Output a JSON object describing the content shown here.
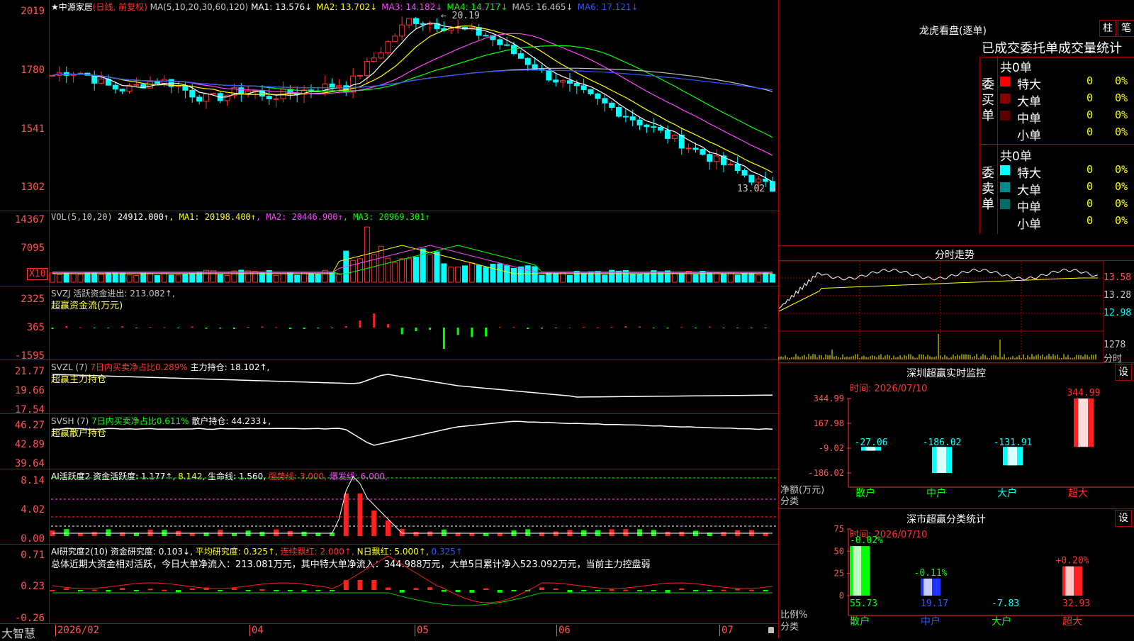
{
  "price_panel": {
    "symbol": "中源家居",
    "mode": "(日线, 前复权)",
    "ma_label": "MA(5,10,20,30,60,120)",
    "ma": [
      {
        "label": "MA1: 13.576↓",
        "color": "#ffffff"
      },
      {
        "label": "MA2: 13.702↓",
        "color": "#ffff00"
      },
      {
        "label": "MA3: 14.182↓",
        "color": "#ff44ff"
      },
      {
        "label": "MA4: 14.717↓",
        "color": "#00ff00"
      },
      {
        "label": "MA5: 16.465↓",
        "color": "#c0c0c0"
      },
      {
        "label": "MA6: 17.121↓",
        "color": "#3355ff"
      }
    ],
    "y_ticks": [
      "2019",
      "1780",
      "1541",
      "1302"
    ],
    "high_label": "20.19",
    "low_label": "13.02"
  },
  "vol_panel": {
    "header": "VOL(5,10,20)",
    "value": "24912.000↑",
    "ma": [
      {
        "label": "MA1: 20198.400↑",
        "color": "#ffff00"
      },
      {
        "label": "MA2: 20446.900↑",
        "color": "#ff44ff"
      },
      {
        "label": "MA3: 20969.301↑",
        "color": "#00ff00"
      }
    ],
    "y_ticks": [
      "14367",
      "7095"
    ],
    "unit": "X10"
  },
  "svzj_panel": {
    "header": "SVZJ 活跃资金进出: 213.082↑,",
    "subtitle": "超赢资金流(万元)",
    "y_ticks": [
      "2325",
      "365",
      "-1595"
    ]
  },
  "svzl_panel": {
    "header_prefix": "SVZL (7)",
    "header_red": "7日内买卖净占比0.289%",
    "header_rest": "主力持仓: 18.102↑,",
    "subtitle": "超赢主力持仓",
    "y_ticks": [
      "21.77",
      "19.66",
      "17.54"
    ]
  },
  "svsh_panel": {
    "header_prefix": "SVSH (7)",
    "header_green": "7日内买卖净占比0.611%",
    "header_rest": "散户持仓: 44.233↓,",
    "subtitle": "超赢散户持仓",
    "y_ticks": [
      "46.27",
      "42.89",
      "39.64"
    ]
  },
  "ai_active_panel": {
    "h1": "AI活跃度2 资金活跃度: 1.177↑,",
    "h2": "8.142,",
    "h3": "生命线: 1.560,",
    "h4": "强势线: 3.000,",
    "h5": "爆发线: 6.000,",
    "y_ticks": [
      "8.14",
      "4.02",
      "0.00"
    ]
  },
  "ai_research_panel": {
    "h1": "AI研究度2(10) 资金研究度: 0.103↓,",
    "h2": "平均研究度: 0.325↑,",
    "h3": "连续飘红: 2.000↑,",
    "h4": "N日飘红: 5.000↑,",
    "h5": "0.325↑",
    "summary": "总体近期大资金相对活跃，今日大单净流入：213.081万元，其中特大单净流入：344.988万元，大单5日累计净入523.092万元，当前主力控盘弱",
    "y_ticks": [
      "0.71",
      "0.23",
      "-0.26"
    ]
  },
  "date_axis": {
    "app_name": "大智慧",
    "labels": [
      "2026/02",
      "04",
      "05",
      "06",
      "07"
    ]
  },
  "dragon_tiger": {
    "title": "龙虎看盘(逐单)",
    "btn1": "柱",
    "btn2": "笔",
    "tabs": "已成交委托单成交量统计",
    "buy": {
      "label": "委买单",
      "total": "共0单",
      "rows": [
        {
          "name": "特大",
          "count": "0",
          "pct": "0%",
          "color": "#ff0000"
        },
        {
          "name": "大单",
          "count": "0",
          "pct": "0%",
          "color": "#8b0000"
        },
        {
          "name": "中单",
          "count": "0",
          "pct": "0%",
          "color": "#5a0000"
        },
        {
          "name": "小单",
          "count": "0",
          "pct": "0%",
          "color": "#000000"
        }
      ]
    },
    "sell": {
      "label": "委卖单",
      "total": "共0单",
      "rows": [
        {
          "name": "特大",
          "count": "0",
          "pct": "0%",
          "color": "#00ffff"
        },
        {
          "name": "大单",
          "count": "0",
          "pct": "0%",
          "color": "#008b8b"
        },
        {
          "name": "中单",
          "count": "0",
          "pct": "0%",
          "color": "#006b6b"
        },
        {
          "name": "小单",
          "count": "0",
          "pct": "0%",
          "color": "#000000"
        }
      ]
    }
  },
  "intraday": {
    "title": "分时走势",
    "y_ticks": [
      "13.58",
      "13.28",
      "12.98"
    ],
    "vol_label": "1278",
    "vol_unit": "分时"
  },
  "monitor": {
    "title": "深圳超赢实时监控",
    "settings": "设",
    "time": "时间: 2026/07/10",
    "y_ticks": [
      "344.99",
      "167.98",
      "-9.02",
      "-186.02"
    ],
    "ylabel": "净额(万元)",
    "xlabel": "分类",
    "bars": [
      {
        "name": "散户",
        "value": -27.06,
        "label": "-27.06",
        "color": "#00ffff"
      },
      {
        "name": "中户",
        "value": -186.02,
        "label": "-186.02",
        "color": "#00ffff"
      },
      {
        "name": "大户",
        "value": -131.91,
        "label": "-131.91",
        "color": "#00ffff"
      },
      {
        "name": "超大",
        "value": 344.99,
        "label": "344.99",
        "color": "#ff3333"
      }
    ]
  },
  "classify": {
    "title": "深市超赢分类统计",
    "settings": "设",
    "time": "时间: 2026/07/10",
    "y_ticks": [
      "75",
      "50",
      "25",
      "0"
    ],
    "ylabel": "比例%",
    "xlabel": "分类",
    "bars": [
      {
        "name": "散户",
        "value": 55.73,
        "top": "-0.02%",
        "bottom": "55.73",
        "top_color": "#00ff00",
        "bottom_color": "#00ff00",
        "fill": "#00ff00"
      },
      {
        "name": "中户",
        "value": 19.17,
        "top": "-0.11%",
        "bottom": "19.17",
        "top_color": "#00ff00",
        "bottom_color": "#3355ff",
        "fill": "#2233ff"
      },
      {
        "name": "大户",
        "value": 0,
        "top": "",
        "bottom": "-7.83",
        "top_color": "#00ff00",
        "bottom_color": "#00ffff",
        "fill": "#00ffff"
      },
      {
        "name": "超大",
        "value": 32.93,
        "top": "+0.20%",
        "bottom": "32.93",
        "top_color": "#ff3333",
        "bottom_color": "#ff3333",
        "fill": "#ff2222"
      }
    ]
  }
}
